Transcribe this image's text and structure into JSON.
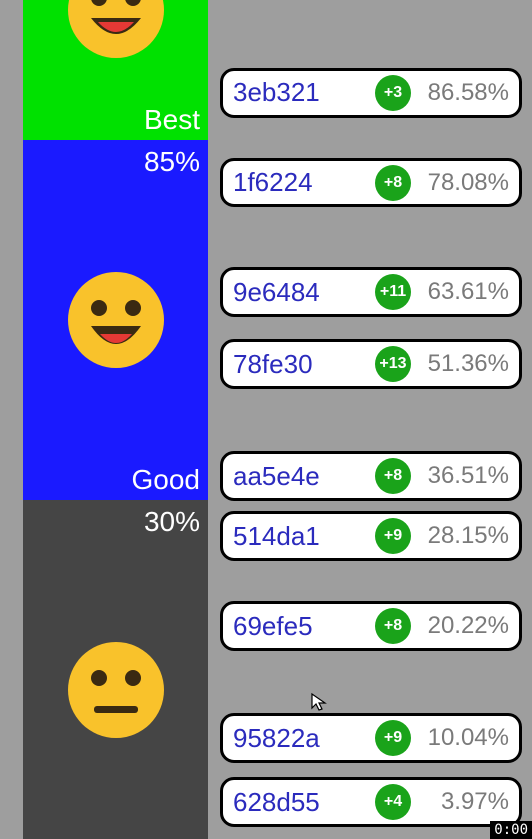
{
  "tiers": {
    "best": {
      "label": "Best",
      "pct": ""
    },
    "good": {
      "label": "Good",
      "pct": "85%"
    },
    "ok": {
      "label": "",
      "pct": "30%"
    }
  },
  "rows": [
    {
      "id": "3eb321",
      "badge": "+3",
      "pv": "86.58%"
    },
    {
      "id": "1f6224",
      "badge": "+8",
      "pv": "78.08%"
    },
    {
      "id": "9e6484",
      "badge": "+11",
      "pv": "63.61%"
    },
    {
      "id": "78fe30",
      "badge": "+13",
      "pv": "51.36%"
    },
    {
      "id": "aa5e4e",
      "badge": "+8",
      "pv": "36.51%"
    },
    {
      "id": "514da1",
      "badge": "+9",
      "pv": "28.15%"
    },
    {
      "id": "69efe5",
      "badge": "+8",
      "pv": "20.22%"
    },
    {
      "id": "95822a",
      "badge": "+9",
      "pv": "10.04%"
    },
    {
      "id": "628d55",
      "badge": "+4",
      "pv": "3.97%"
    }
  ],
  "timer": "0:00",
  "colors": {
    "best": "#00e100",
    "good": "#1a1aff",
    "ok": "#454545",
    "badge": "#1aa31a",
    "id_text": "#2b2bbd"
  }
}
